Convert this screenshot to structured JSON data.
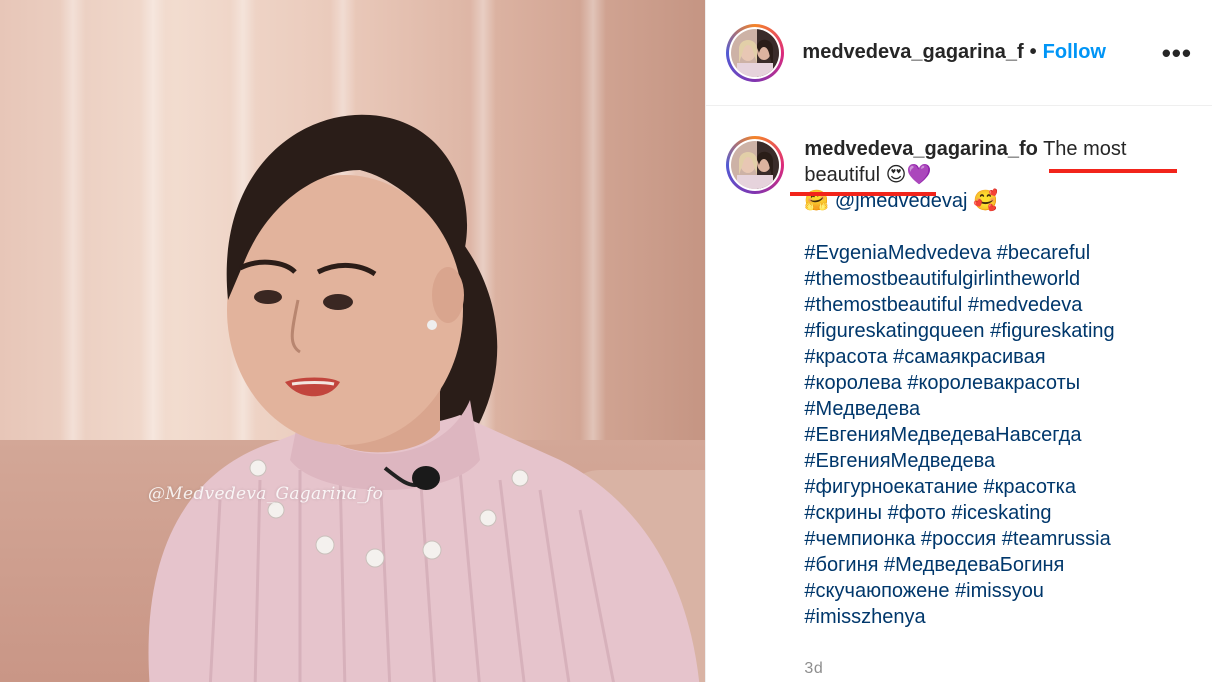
{
  "header": {
    "username": "medvedeva_gagarina_f",
    "separator": "•",
    "follow_label": "Follow",
    "more_label": "•••"
  },
  "caption": {
    "username": "medvedeva_gagarina_fo",
    "text": "The most beautiful",
    "emoji_after_text": "😍💜",
    "emoji_before_mention": "🤗",
    "mention": "@jmedvedevaj",
    "emoji_after_mention": "🥰",
    "hashtag_lines": [
      "#EvgeniaMedvedeva #becareful",
      "#themostbeautifulgirlintheworld",
      "#themostbeautiful #medvedeva",
      "#figureskatingqueen #figureskating",
      "#красота #самаякрасивая",
      "#королева #королевакрасоты",
      "#Медведева",
      "#ЕвгенияМедведеваНавсегда",
      "#ЕвгенияМедведева",
      "#фигурноекатание #красотка",
      "#скрины #фото #iceskating",
      "#чемпионка #россия #teamrussia",
      "#богиня #МедведеваБогиня",
      "#скучаюпожене #imissyou",
      "#imisszhenya"
    ],
    "timestamp": "3d"
  },
  "photo": {
    "watermark": "@Medvedeva_Gagarina_fo"
  },
  "colors": {
    "link": "#00376b",
    "follow": "#0095f6",
    "annotation": "#f2241b",
    "muted": "#8e8e8e"
  }
}
